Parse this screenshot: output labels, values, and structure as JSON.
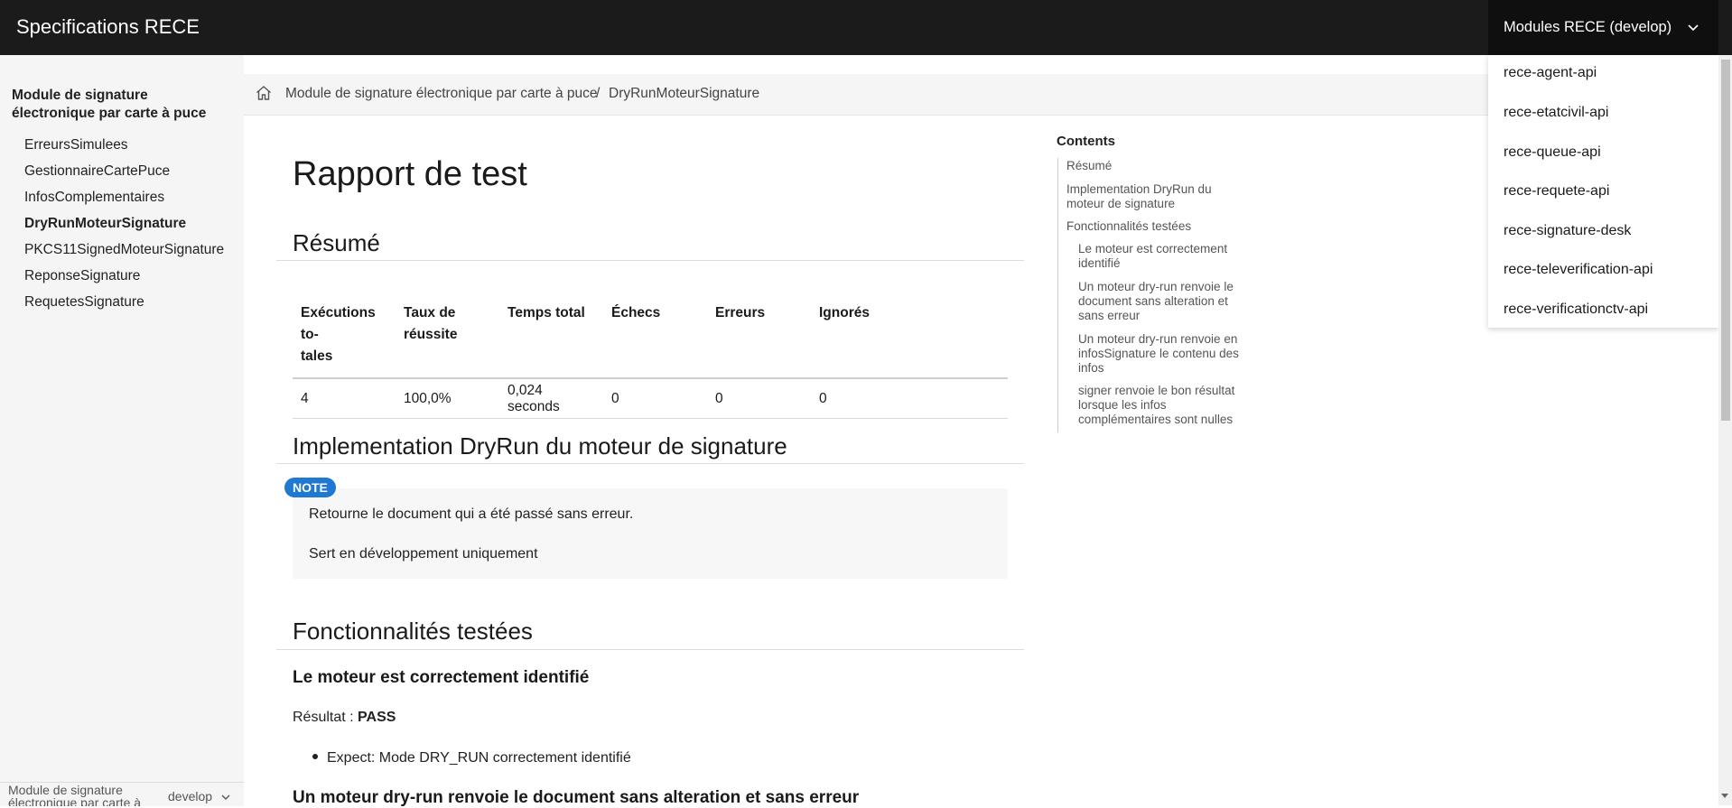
{
  "header": {
    "site_title": "Specifications RECE",
    "modules_label": "Modules RECE (develop)"
  },
  "modules_menu": [
    "rece-agent-api",
    "rece-etatcivil-api",
    "rece-queue-api",
    "rece-requete-api",
    "rece-signature-desk",
    "rece-televerification-api",
    "rece-verificationctv-api"
  ],
  "sidebar": {
    "section_title": "Module de signature électronique par carte à puce",
    "items": [
      {
        "label": "ErreursSimulees",
        "active": false
      },
      {
        "label": "GestionnaireCartePuce",
        "active": false
      },
      {
        "label": "InfosComplementaires",
        "active": false
      },
      {
        "label": "DryRunMoteurSignature",
        "active": true
      },
      {
        "label": "PKCS11SignedMoteurSignature",
        "active": false
      },
      {
        "label": "ReponseSignature",
        "active": false
      },
      {
        "label": "RequetesSignature",
        "active": false
      }
    ],
    "footer_module": "Module de signature électronique par carte à puce",
    "footer_version": "develop"
  },
  "breadcrumb": {
    "parent": "Module de signature électronique par carte à puce",
    "separator": "/",
    "current": "DryRunMoteurSignature"
  },
  "main": {
    "title": "Rapport de test",
    "summary_heading": "Résumé",
    "summary_table": {
      "headers": [
        "Exécutions to-tales",
        "Taux de réussite",
        "Temps total",
        "Échecs",
        "Erreurs",
        "Ignorés"
      ],
      "headers_display": [
        [
          "Exécutions to-",
          "tales"
        ],
        [
          "Taux de réussite"
        ],
        [
          "Temps total"
        ],
        [
          "Échecs"
        ],
        [
          "Erreurs"
        ],
        [
          "Ignorés"
        ]
      ],
      "row": [
        "4",
        "100,0%",
        "0,024 seconds",
        "0",
        "0",
        "0"
      ]
    },
    "impl_heading": "Implementation DryRun du moteur de signature",
    "note": {
      "badge": "NOTE",
      "lines": [
        "Retourne le document qui a été passé sans erreur.",
        "Sert en développement uniquement"
      ]
    },
    "features_heading": "Fonctionnalités testées",
    "feature1": {
      "title": "Le moteur est correctement identifié",
      "result_label": "Résultat : ",
      "result_value": "PASS",
      "expect": "Expect: Mode DRY_RUN correctement identifié"
    },
    "feature2_title": "Un moteur dry-run renvoie le document sans alteration et sans erreur"
  },
  "toc": {
    "title": "Contents",
    "items": [
      {
        "label": "Résumé",
        "level": 1
      },
      {
        "label": "Implementation DryRun du moteur de signature",
        "level": 1
      },
      {
        "label": "Fonctionnalités testées",
        "level": 1
      },
      {
        "label": "Le moteur est correctement identifié",
        "level": 2
      },
      {
        "label": "Un moteur dry-run renvoie le document sans alteration et sans erreur",
        "level": 2
      },
      {
        "label": "Un moteur dry-run renvoie en infosSignature le contenu des infos",
        "level": 2
      },
      {
        "label": "signer renvoie le bon résultat lorsque les infos complémentaires sont nulles",
        "level": 2
      }
    ]
  }
}
